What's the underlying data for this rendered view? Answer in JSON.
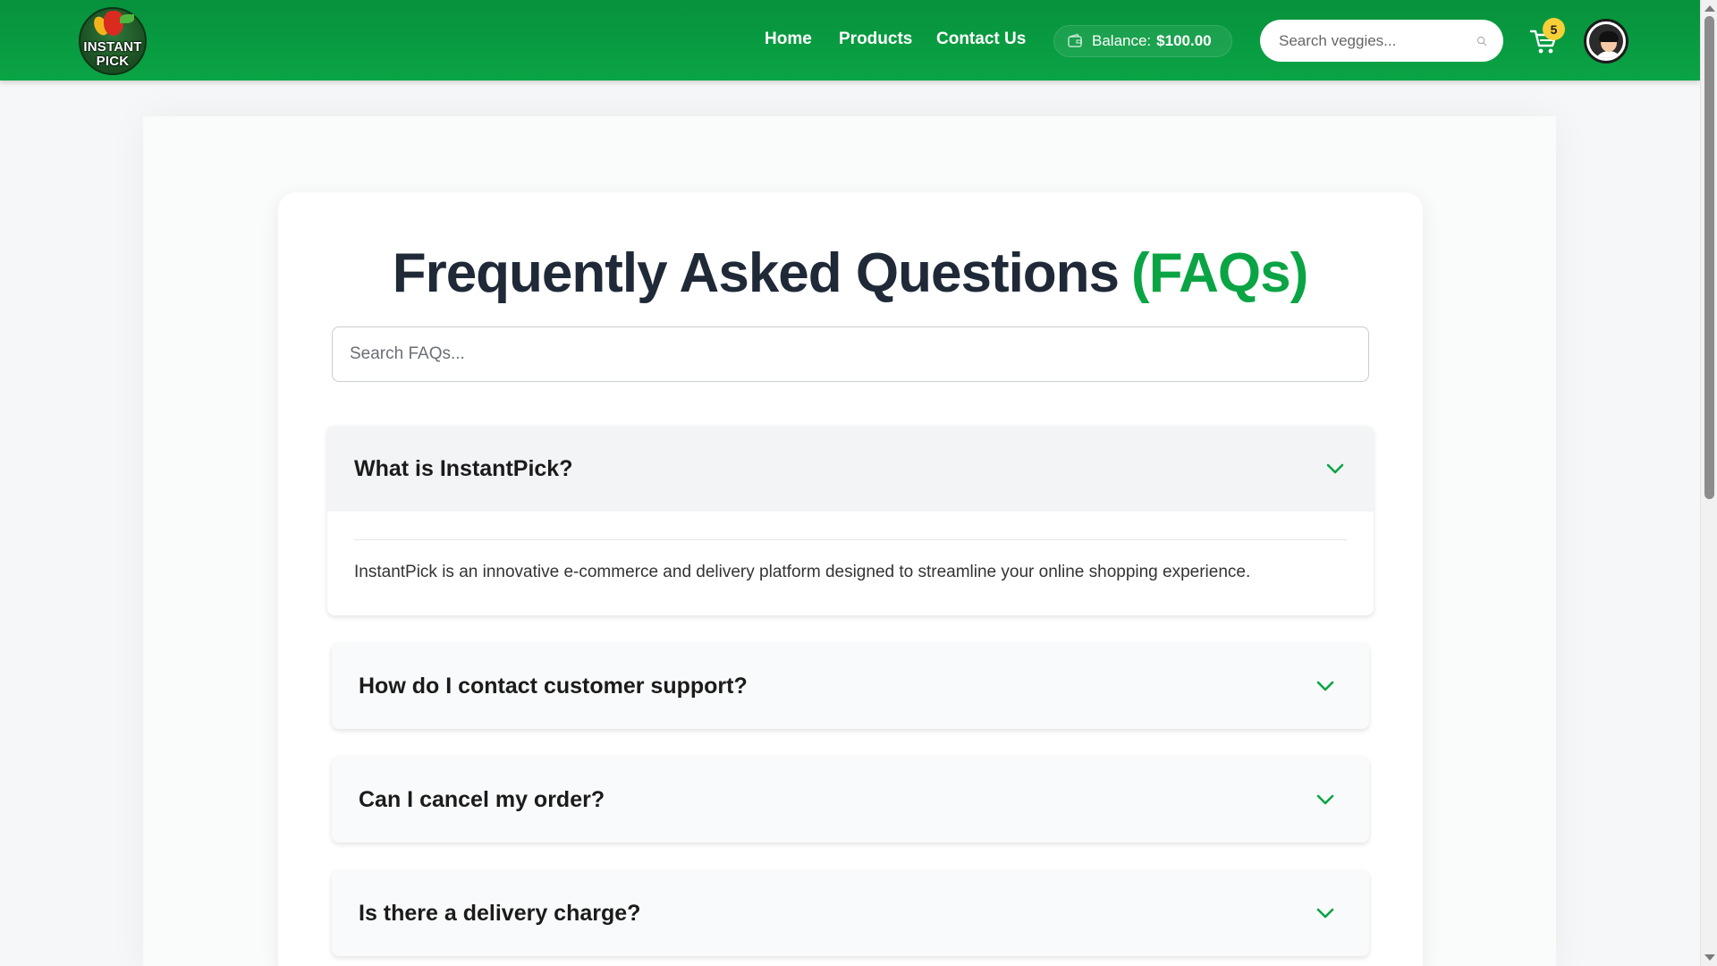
{
  "brand": {
    "logo_line1": "INSTANT",
    "logo_line2": "PICK"
  },
  "nav": {
    "home": "Home",
    "products": "Products",
    "contact": "Contact Us"
  },
  "balance": {
    "label": "Balance:",
    "amount": "$100.00"
  },
  "search": {
    "placeholder": "Search veggies..."
  },
  "cart": {
    "count": "5"
  },
  "faq": {
    "title": "Frequently Asked Questions",
    "title_accent": "(FAQs)",
    "search_placeholder": "Search FAQs...",
    "items": [
      {
        "question": "What is InstantPick?",
        "answer": "InstantPick is an innovative e-commerce and delivery platform designed to streamline your online shopping experience.",
        "expanded": true
      },
      {
        "question": "How do I contact customer support?",
        "expanded": false
      },
      {
        "question": "Can I cancel my order?",
        "expanded": false
      },
      {
        "question": "Is there a delivery charge?",
        "expanded": false
      }
    ]
  },
  "colors": {
    "brand_green": "#0aa445",
    "badge_yellow": "#f7d038",
    "heading_dark": "#1f2937"
  },
  "icons": [
    "wallet-icon",
    "search-icon",
    "cart-icon",
    "user-avatar",
    "chevron-down-icon"
  ]
}
